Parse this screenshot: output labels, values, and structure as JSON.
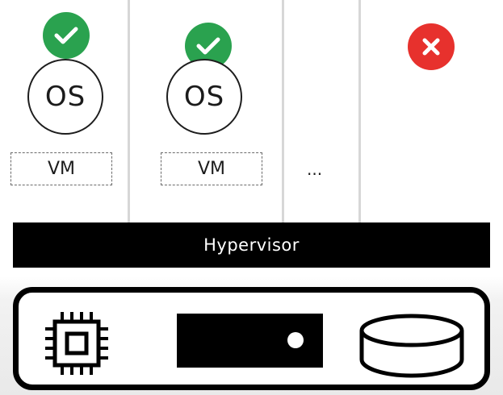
{
  "stack": {
    "slots": [
      {
        "os_label": "OS",
        "vm_label": "VM",
        "status": "check-icon"
      },
      {
        "os_label": "OS",
        "vm_label": "VM",
        "status": "check-icon"
      },
      {
        "more_label": "..."
      },
      {
        "status": "x-icon"
      }
    ],
    "hypervisor_label": "Hypervisor"
  },
  "hardware": {
    "icons": [
      "cpu-chip-icon",
      "server-icon",
      "storage-disk-icon"
    ]
  },
  "colors": {
    "success": "#2aa24f",
    "error": "#e7312d",
    "dark": "#000000",
    "divider": "#d7d7d7"
  }
}
